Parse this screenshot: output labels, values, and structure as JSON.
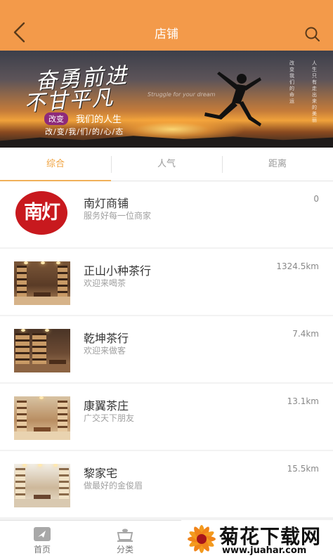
{
  "header": {
    "title": "店铺",
    "back_icon": "chevron-left-icon",
    "search_icon": "search-icon",
    "background": "#f39a4a"
  },
  "banner": {
    "slogan_line1": "奋勇前进",
    "slogan_line2": "不甘平凡",
    "tagline": "Struggle for your dream",
    "pill": "改变",
    "pill_text": "我们的人生",
    "subline": "改/变/我/们/的/心/态",
    "vertical_left": "改变我们的命运",
    "vertical_right": "人生只有走出来的美丽"
  },
  "tabs": [
    {
      "label": "综合",
      "active": true
    },
    {
      "label": "人气",
      "active": false
    },
    {
      "label": "距离",
      "active": false
    }
  ],
  "shops": [
    {
      "name": "南灯商铺",
      "desc": "服务好每一位商家",
      "distance": "0",
      "logo_text": "南灯"
    },
    {
      "name": "正山小种茶行",
      "desc": "欢迎来喝茶",
      "distance": "1324.5km"
    },
    {
      "name": "乾坤茶行",
      "desc": "欢迎来做客",
      "distance": "7.4km"
    },
    {
      "name": "康翼茶庄",
      "desc": "广交天下朋友",
      "distance": "13.1km"
    },
    {
      "name": "黎家宅",
      "desc": "做最好的金俊眉",
      "distance": "15.5km"
    }
  ],
  "bottom_nav": [
    {
      "label": "首页",
      "icon": "home-icon"
    },
    {
      "label": "分类",
      "icon": "category-icon"
    }
  ],
  "watermark": {
    "title": "菊花下载网",
    "url": "www.juahar.com"
  },
  "colors": {
    "accent": "#f0a23c",
    "brand_red": "#c8191e"
  }
}
